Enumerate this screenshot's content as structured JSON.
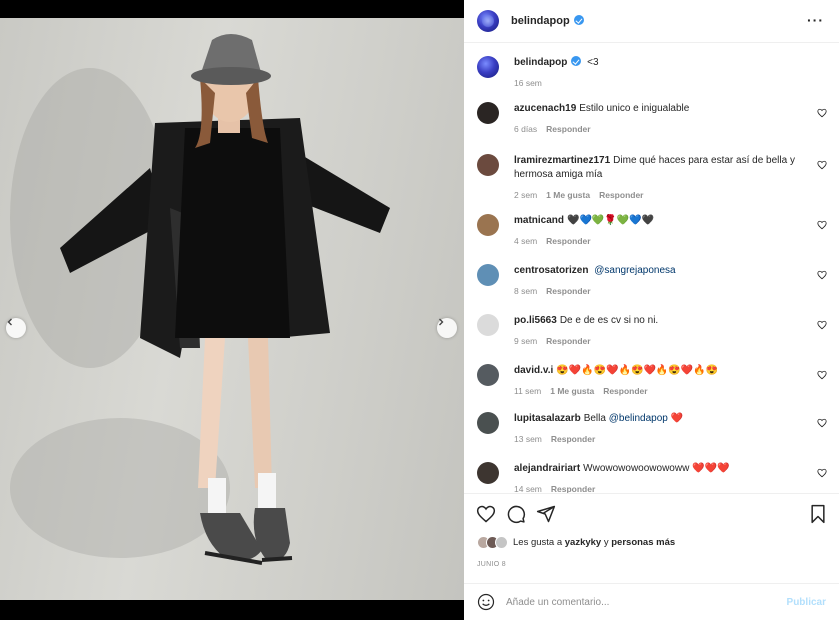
{
  "post": {
    "username": "belindapop",
    "more_icon": "more-horizontal-icon",
    "caption": {
      "username": "belindapop",
      "text": "<3",
      "time": "16 sem"
    }
  },
  "comments": [
    {
      "username": "azucenach19",
      "text": "Estilo unico e inigualable",
      "time": "6 días",
      "likes": "",
      "reply": "Responder",
      "avatar_color": "#2a2523"
    },
    {
      "username": "lramirezmartinez171",
      "text": "Dime qué haces para estar así de bella y hermosa amiga mía",
      "time": "2 sem",
      "likes": "1 Me gusta",
      "reply": "Responder",
      "avatar_color": "#6b4a3e"
    },
    {
      "username": "matnicand",
      "text": "🖤💙💚🌹💚💙🖤",
      "time": "4 sem",
      "likes": "",
      "reply": "Responder",
      "avatar_color": "#9a7450"
    },
    {
      "username": "centrosatorizen",
      "text": "",
      "mention": "@sangrejaponesa",
      "time": "8 sem",
      "likes": "",
      "reply": "Responder",
      "avatar_color": "#5f8fb5"
    },
    {
      "username": "po.li5663",
      "text": "De e de es cv si no ni.",
      "time": "9 sem",
      "likes": "",
      "reply": "Responder",
      "avatar_color": "#dbdbdb"
    },
    {
      "username": "david.v.i",
      "text": "😍❤️🔥😍❤️🔥😍❤️🔥😍❤️🔥😍",
      "time": "11 sem",
      "likes": "1 Me gusta",
      "reply": "Responder",
      "avatar_color": "#555b60"
    },
    {
      "username": "lupitasalazarb",
      "text": "Bella",
      "mention": "@belindapop",
      "suffix": "❤️",
      "time": "13 sem",
      "likes": "",
      "reply": "Responder",
      "avatar_color": "#4a5050"
    },
    {
      "username": "alejandrairiart",
      "text": "Wwowowowoowowoww ❤️❤️❤️",
      "time": "14 sem",
      "likes": "",
      "reply": "Responder",
      "avatar_color": "#3d3530"
    }
  ],
  "actions": {
    "like_icon": "heart-icon",
    "comment_icon": "comment-icon",
    "share_icon": "send-icon",
    "save_icon": "bookmark-icon"
  },
  "likes_line": {
    "prefix": "Les gusta a",
    "user": "yazkyky",
    "connector": "y",
    "others": "personas más"
  },
  "date": "JUNIO 8",
  "add_comment": {
    "emoji_icon": "emoji-icon",
    "placeholder": "Añade un comentario...",
    "post_label": "Publicar"
  },
  "carousel": {
    "prev_icon": "chevron-left-icon",
    "next_icon": "chevron-right-icon",
    "total": 3,
    "active_index": 0
  },
  "colors": {
    "verified": "#3897f0",
    "link": "#00376b",
    "muted": "#8e8e8e",
    "post_disabled": "#b2dffc",
    "heart_red": "#ed4956"
  }
}
